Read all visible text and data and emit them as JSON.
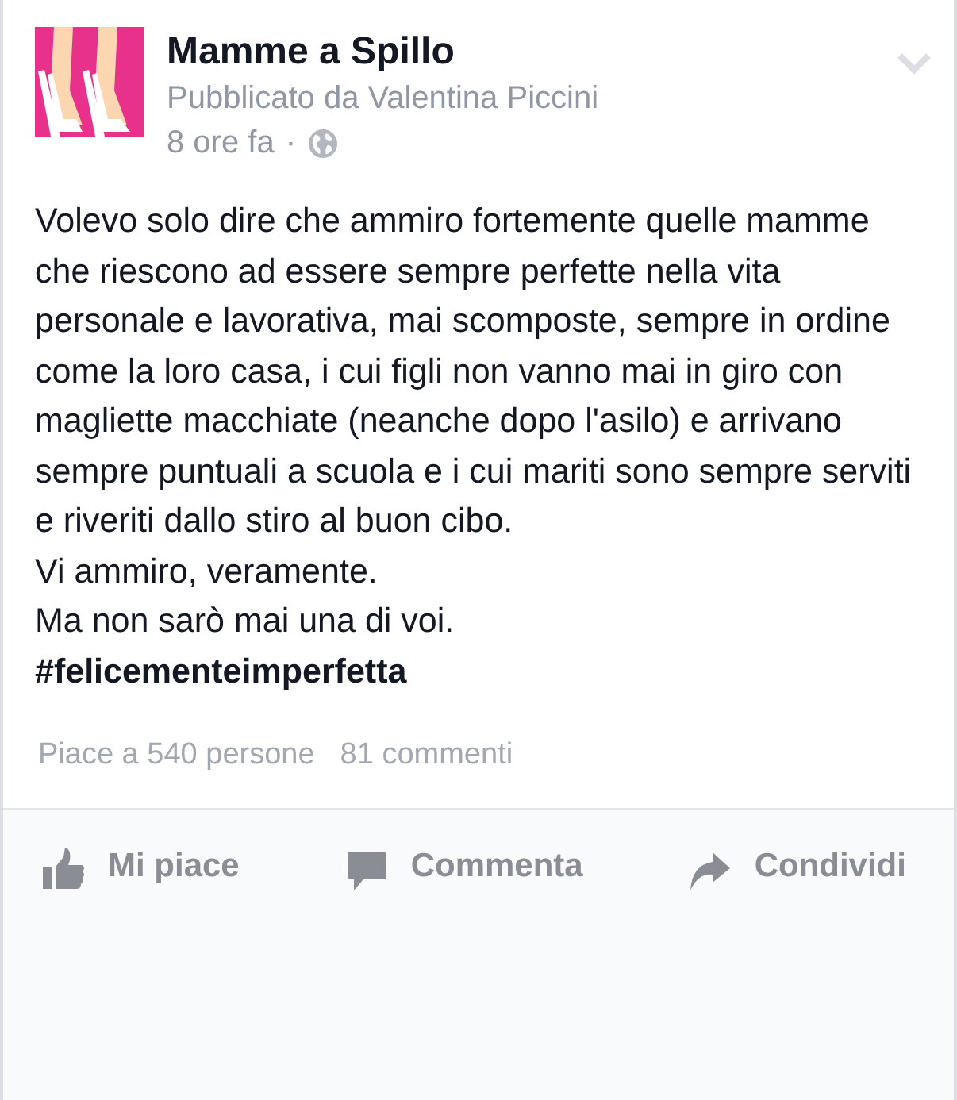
{
  "post": {
    "page_name": "Mamme a Spillo",
    "posted_by": "Pubblicato da Valentina Piccini",
    "time": "8 ore fa",
    "separator": "·",
    "body": [
      "Volevo solo dire che ammiro fortemente quelle mamme che riescono ad essere sempre perfette nella vita personale e lavorativa, mai scomposte, sempre in ordine come la loro casa, i cui figli non vanno mai in giro con magliette macchiate (neanche dopo l'asilo) e arrivano sempre puntuali a scuola e i cui mariti sono sempre serviti e riveriti dallo stiro al buon cibo.",
      "Vi ammiro, veramente.",
      "Ma non sarò mai una di voi."
    ],
    "hashtag": "#felicementeimperfetta",
    "likes": "Piace a 540 persone",
    "comments": "81 commenti"
  },
  "actions": [
    {
      "kind": "like",
      "label": "Mi piace"
    },
    {
      "kind": "comment",
      "label": "Commenta"
    },
    {
      "kind": "share",
      "label": "Condividi"
    }
  ]
}
